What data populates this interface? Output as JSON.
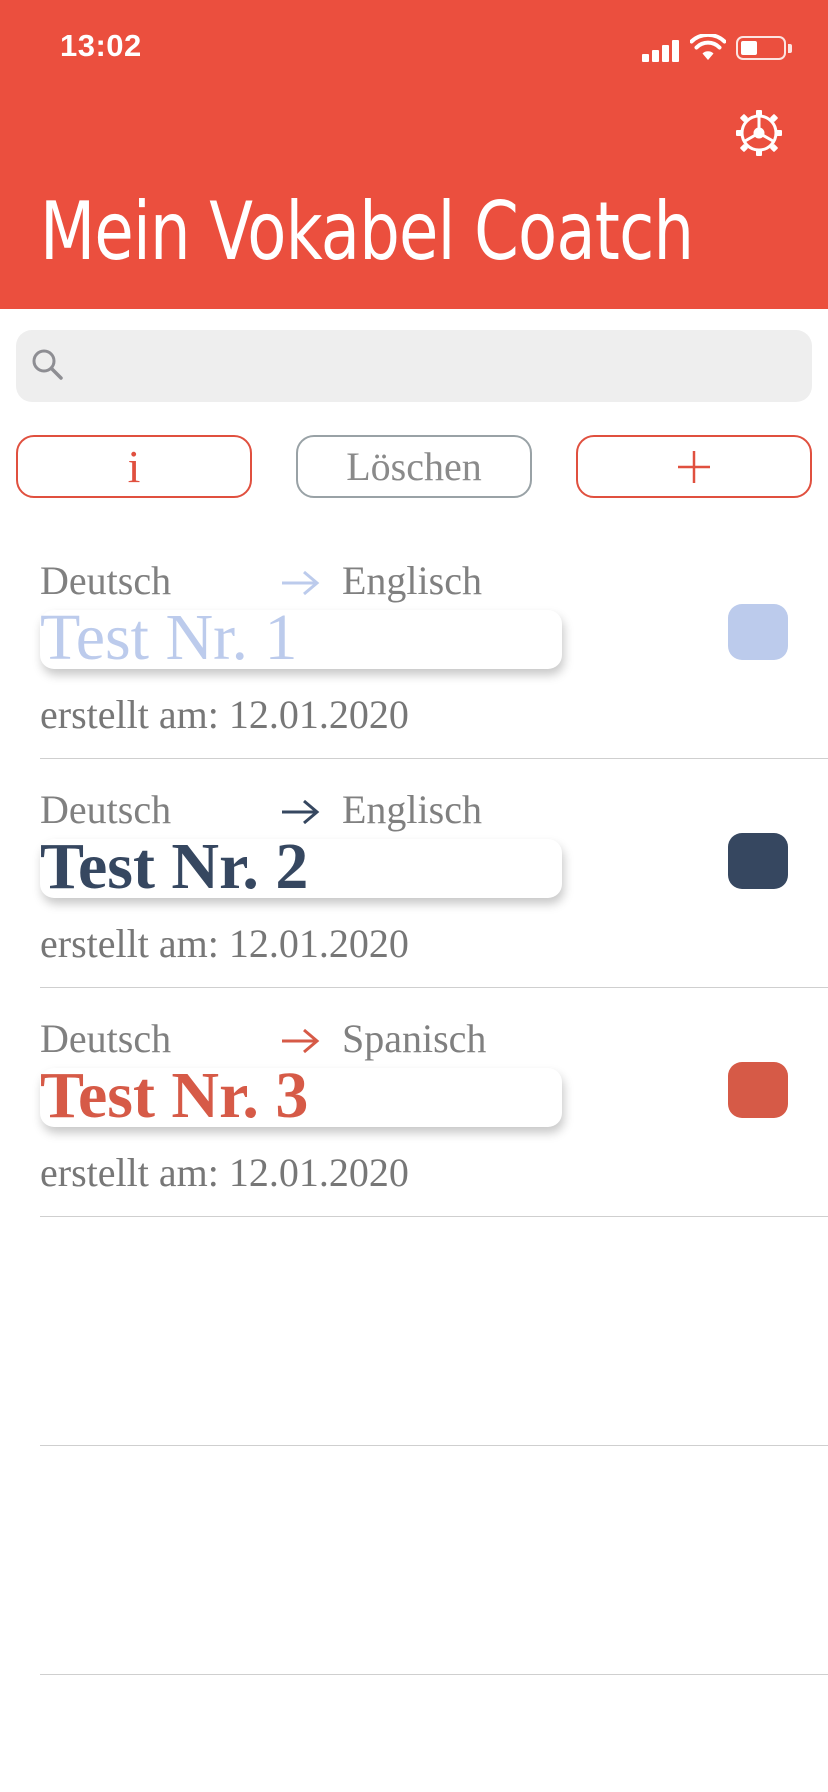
{
  "status_bar": {
    "time": "13:02"
  },
  "header": {
    "title": "Mein Vokabel Coatch",
    "background": "#eb4f3e",
    "settings_icon": "gear-icon"
  },
  "search": {
    "placeholder": "",
    "value": "",
    "icon": "search-icon"
  },
  "toolbar": {
    "info_label": "i",
    "delete_label": "Löschen",
    "add_icon": "plus-icon"
  },
  "tests": [
    {
      "source_language": "Deutsch",
      "target_language": "Englisch",
      "name": "Test Nr. 1",
      "created": "erstellt am: 12.01.2020",
      "color": "#bccbec",
      "name_style": "normal"
    },
    {
      "source_language": "Deutsch",
      "target_language": "Englisch",
      "name": "Test Nr. 2",
      "created": "erstellt am: 12.01.2020",
      "color": "#364760",
      "name_style": "bold"
    },
    {
      "source_language": "Deutsch",
      "target_language": "Spanisch",
      "name": "Test Nr. 3",
      "created": "erstellt am: 12.01.2020",
      "color": "#d65a47",
      "name_style": "bold"
    }
  ]
}
